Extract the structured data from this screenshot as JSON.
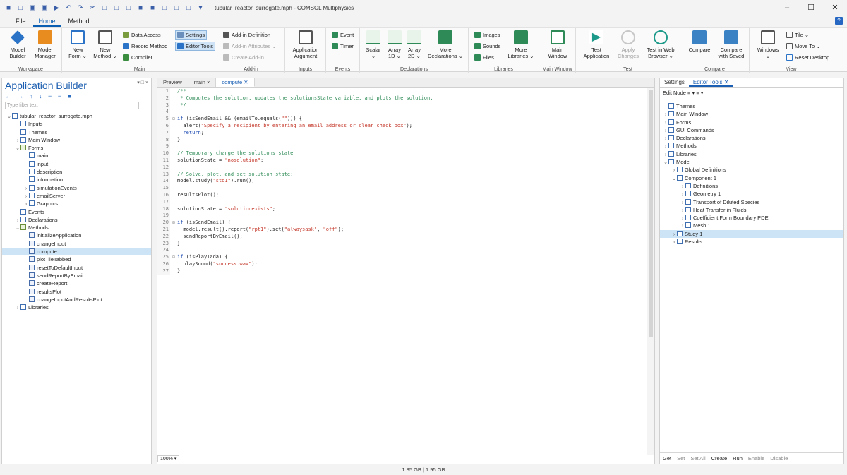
{
  "window": {
    "title": "tubular_reactor_surrogate.mph - COMSOL Multiphysics",
    "controls": [
      "–",
      "☐",
      "✕"
    ],
    "quick_access": [
      "■",
      "□",
      "▣",
      "▣",
      "▶",
      "↶",
      "↷",
      "✂",
      "□",
      "□",
      "□",
      "■",
      "■",
      "□",
      "□",
      "□",
      "▾"
    ]
  },
  "menu": {
    "file": "File",
    "home": "Home",
    "method": "Method",
    "help": "?"
  },
  "ribbon": {
    "workspace": {
      "label": "Workspace",
      "model_builder": "Model\nBuilder",
      "model_manager": "Model\nManager"
    },
    "main": {
      "label": "Main",
      "new_form": "New\nForm ⌄",
      "new_method": "New\nMethod ⌄",
      "data_access": "Data Access",
      "record_method": "Record Method",
      "compiler": "Compiler",
      "settings": "Settings",
      "editor_tools": "Editor Tools"
    },
    "addin": {
      "label": "Add-in",
      "add_in_definition": "Add-in Definition",
      "add_in_attributes": "Add-in Attributes ⌄",
      "create_add_in": "Create Add-in"
    },
    "inputs": {
      "label": "Inputs",
      "application_argument": "Application\nArgument"
    },
    "events": {
      "label": "Events",
      "event": "Event",
      "timer": "Timer"
    },
    "declarations": {
      "label": "Declarations",
      "scalar": "Scalar\n⌄",
      "array1d": "Array\n1D ⌄",
      "array2d": "Array\n2D ⌄",
      "more_declarations": "More\nDeclarations ⌄"
    },
    "libraries": {
      "label": "Libraries",
      "images": "Images",
      "sounds": "Sounds",
      "files": "Files",
      "more_libraries": "More\nLibraries ⌄"
    },
    "main_window": {
      "label": "Main Window",
      "main_window": "Main\nWindow"
    },
    "test": {
      "label": "Test",
      "test_application": "Test\nApplication",
      "apply_changes": "Apply\nChanges",
      "test_in_web_browser": "Test in Web\nBrowser ⌄"
    },
    "compare": {
      "label": "Compare",
      "compare": "Compare",
      "compare_with_saved": "Compare\nwith Saved"
    },
    "view": {
      "label": "View",
      "windows": "Windows\n⌄",
      "tile": "Tile ⌄",
      "move_to": "Move To ⌄",
      "reset_desktop": "Reset Desktop"
    }
  },
  "app_builder": {
    "title": "Application Builder",
    "toolbar": "← → ↑ ↓ ≡ ≡ ■",
    "filter_placeholder": "Type filter text",
    "tree": [
      {
        "label": "tubular_reactor_surrogate.mph",
        "level": 0,
        "arrow": "⌄",
        "kind": "root"
      },
      {
        "label": "Inputs",
        "level": 1,
        "arrow": "",
        "kind": "item"
      },
      {
        "label": "Themes",
        "level": 1,
        "arrow": "",
        "kind": "item"
      },
      {
        "label": "Main Window",
        "level": 1,
        "arrow": "›",
        "kind": "item"
      },
      {
        "label": "Forms",
        "level": 1,
        "arrow": "⌄",
        "kind": "fold"
      },
      {
        "label": "main",
        "level": 2,
        "arrow": "",
        "kind": "item"
      },
      {
        "label": "input",
        "level": 2,
        "arrow": "",
        "kind": "item"
      },
      {
        "label": "description",
        "level": 2,
        "arrow": "",
        "kind": "item"
      },
      {
        "label": "information",
        "level": 2,
        "arrow": "",
        "kind": "item"
      },
      {
        "label": "simulationEvents",
        "level": 2,
        "arrow": "›",
        "kind": "item"
      },
      {
        "label": "emailServer",
        "level": 2,
        "arrow": "›",
        "kind": "item"
      },
      {
        "label": "Graphics",
        "level": 2,
        "arrow": "›",
        "kind": "item"
      },
      {
        "label": "Events",
        "level": 1,
        "arrow": "",
        "kind": "item"
      },
      {
        "label": "Declarations",
        "level": 1,
        "arrow": "›",
        "kind": "item"
      },
      {
        "label": "Methods",
        "level": 1,
        "arrow": "⌄",
        "kind": "fold"
      },
      {
        "label": "initializeApplication",
        "level": 2,
        "arrow": "",
        "kind": "meth"
      },
      {
        "label": "changeInput",
        "level": 2,
        "arrow": "",
        "kind": "meth"
      },
      {
        "label": "compute",
        "level": 2,
        "arrow": "",
        "kind": "meth",
        "selected": true
      },
      {
        "label": "plotTileTabbed",
        "level": 2,
        "arrow": "",
        "kind": "meth"
      },
      {
        "label": "resetToDefaultInput",
        "level": 2,
        "arrow": "",
        "kind": "meth"
      },
      {
        "label": "sendReportByEmail",
        "level": 2,
        "arrow": "",
        "kind": "meth"
      },
      {
        "label": "createReport",
        "level": 2,
        "arrow": "",
        "kind": "meth"
      },
      {
        "label": "resultsPlot",
        "level": 2,
        "arrow": "",
        "kind": "meth"
      },
      {
        "label": "changeInputAndResultsPlot",
        "level": 2,
        "arrow": "",
        "kind": "meth"
      },
      {
        "label": "Libraries",
        "level": 1,
        "arrow": "›",
        "kind": "item"
      }
    ]
  },
  "editor": {
    "tabs": [
      {
        "label": "Preview",
        "active": false
      },
      {
        "label": "main ×",
        "active": false
      },
      {
        "label": "compute ✕",
        "active": true
      }
    ],
    "zoom": "100% ▾",
    "lines": [
      {
        "n": "1",
        "f": "",
        "parts": [
          {
            "t": "/**",
            "c": "com"
          }
        ]
      },
      {
        "n": "2",
        "f": "",
        "parts": [
          {
            "t": " * Computes the solution, updates the solutionsState variable, and plots the solution.",
            "c": "com"
          }
        ]
      },
      {
        "n": "3",
        "f": "",
        "parts": [
          {
            "t": " */",
            "c": "com"
          }
        ]
      },
      {
        "n": "4",
        "f": "",
        "parts": []
      },
      {
        "n": "5",
        "f": "⊟",
        "parts": [
          {
            "t": "if",
            "c": "kw"
          },
          {
            "t": " (isSendEmail && (emailTo.equals(",
            "c": ""
          },
          {
            "t": "\"\"",
            "c": "str"
          },
          {
            "t": "))) {",
            "c": ""
          }
        ]
      },
      {
        "n": "6",
        "f": "",
        "parts": [
          {
            "t": "  alert(",
            "c": ""
          },
          {
            "t": "\"Specify_a_recipient_by_entering_an_email_address_or_clear_check_box\"",
            "c": "str"
          },
          {
            "t": ");",
            "c": ""
          }
        ]
      },
      {
        "n": "7",
        "f": "",
        "parts": [
          {
            "t": "  return",
            "c": "kw"
          },
          {
            "t": ";",
            "c": ""
          }
        ]
      },
      {
        "n": "8",
        "f": "",
        "parts": [
          {
            "t": "}",
            "c": ""
          }
        ]
      },
      {
        "n": "9",
        "f": "",
        "parts": []
      },
      {
        "n": "10",
        "f": "",
        "parts": [
          {
            "t": "// Temporary change the solutions state",
            "c": "com"
          }
        ]
      },
      {
        "n": "11",
        "f": "",
        "parts": [
          {
            "t": "solutionState = ",
            "c": ""
          },
          {
            "t": "\"nosolution\"",
            "c": "str"
          },
          {
            "t": ";",
            "c": ""
          }
        ]
      },
      {
        "n": "12",
        "f": "",
        "parts": []
      },
      {
        "n": "13",
        "f": "",
        "parts": [
          {
            "t": "// Solve, plot, and set solution state:",
            "c": "com"
          }
        ]
      },
      {
        "n": "14",
        "f": "",
        "parts": [
          {
            "t": "model.study(",
            "c": ""
          },
          {
            "t": "\"std1\"",
            "c": "str"
          },
          {
            "t": ").run();",
            "c": ""
          }
        ]
      },
      {
        "n": "15",
        "f": "",
        "parts": []
      },
      {
        "n": "16",
        "f": "",
        "parts": [
          {
            "t": "resultsPlot();",
            "c": ""
          }
        ]
      },
      {
        "n": "17",
        "f": "",
        "parts": []
      },
      {
        "n": "18",
        "f": "",
        "parts": [
          {
            "t": "solutionState = ",
            "c": ""
          },
          {
            "t": "\"solutionexists\"",
            "c": "str"
          },
          {
            "t": ";",
            "c": ""
          }
        ]
      },
      {
        "n": "19",
        "f": "",
        "parts": []
      },
      {
        "n": "20",
        "f": "⊟",
        "parts": [
          {
            "t": "if",
            "c": "kw"
          },
          {
            "t": " (isSendEmail) {",
            "c": ""
          }
        ]
      },
      {
        "n": "21",
        "f": "",
        "parts": [
          {
            "t": "  model.result().report(",
            "c": ""
          },
          {
            "t": "\"rpt1\"",
            "c": "str"
          },
          {
            "t": ").set(",
            "c": ""
          },
          {
            "t": "\"alwaysask\"",
            "c": "str"
          },
          {
            "t": ", ",
            "c": ""
          },
          {
            "t": "\"off\"",
            "c": "str"
          },
          {
            "t": ");",
            "c": ""
          }
        ]
      },
      {
        "n": "22",
        "f": "",
        "parts": [
          {
            "t": "  sendReportByEmail();",
            "c": ""
          }
        ]
      },
      {
        "n": "23",
        "f": "",
        "parts": [
          {
            "t": "}",
            "c": ""
          }
        ]
      },
      {
        "n": "24",
        "f": "",
        "parts": []
      },
      {
        "n": "25",
        "f": "⊟",
        "parts": [
          {
            "t": "if",
            "c": "kw"
          },
          {
            "t": " (isPlayTada) {",
            "c": ""
          }
        ]
      },
      {
        "n": "26",
        "f": "",
        "parts": [
          {
            "t": "  playSound(",
            "c": ""
          },
          {
            "t": "\"success.wav\"",
            "c": "str"
          },
          {
            "t": ");",
            "c": ""
          }
        ]
      },
      {
        "n": "27",
        "f": "",
        "parts": [
          {
            "t": "}",
            "c": ""
          }
        ]
      }
    ]
  },
  "right_panel": {
    "tabs": [
      {
        "label": "Settings",
        "active": false
      },
      {
        "label": "Editor Tools ✕",
        "active": true
      }
    ],
    "toolbar": "Edit Node ≡ ▾ ≡ ▾",
    "tree": [
      {
        "label": "Themes",
        "level": 0,
        "arrow": ""
      },
      {
        "label": "Main Window",
        "level": 0,
        "arrow": "›"
      },
      {
        "label": "Forms",
        "level": 0,
        "arrow": "›"
      },
      {
        "label": "GUI Commands",
        "level": 0,
        "arrow": "›"
      },
      {
        "label": "Declarations",
        "level": 0,
        "arrow": "›"
      },
      {
        "label": "Methods",
        "level": 0,
        "arrow": "›"
      },
      {
        "label": "Libraries",
        "level": 0,
        "arrow": "›"
      },
      {
        "label": "Model",
        "level": 0,
        "arrow": "⌄"
      },
      {
        "label": "Global Definitions",
        "level": 1,
        "arrow": "›"
      },
      {
        "label": "Component 1",
        "level": 1,
        "arrow": "⌄"
      },
      {
        "label": "Definitions",
        "level": 2,
        "arrow": "›"
      },
      {
        "label": "Geometry 1",
        "level": 2,
        "arrow": "›"
      },
      {
        "label": "Transport of Diluted Species",
        "level": 2,
        "arrow": "›"
      },
      {
        "label": "Heat Transfer in Fluids",
        "level": 2,
        "arrow": "›"
      },
      {
        "label": "Coefficient Form Boundary PDE",
        "level": 2,
        "arrow": "›"
      },
      {
        "label": "Mesh 1",
        "level": 2,
        "arrow": "›"
      },
      {
        "label": "Study 1",
        "level": 1,
        "arrow": "›",
        "selected": true
      },
      {
        "label": "Results",
        "level": 1,
        "arrow": "›"
      }
    ],
    "footer": {
      "get": "Get",
      "set": "Set",
      "set_all": "Set All",
      "create": "Create",
      "run": "Run",
      "enable": "Enable",
      "disable": "Disable"
    }
  },
  "status": {
    "memory": "1.85 GB | 1.95 GB"
  }
}
